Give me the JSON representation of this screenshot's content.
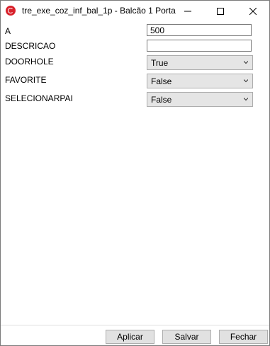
{
  "window": {
    "title": "tre_exe_coz_inf_bal_1p - Balcão 1 Porta",
    "icon": "app-logo-icon",
    "controls": [
      "minimize-icon",
      "maximize-icon",
      "close-icon"
    ]
  },
  "properties": [
    {
      "label": "A",
      "kind": "text",
      "value": "500"
    },
    {
      "label": "DESCRICAO",
      "kind": "text",
      "value": ""
    },
    {
      "label": "DOORHOLE",
      "kind": "select",
      "value": "True"
    },
    {
      "label": "FAVORITE",
      "kind": "select",
      "value": "False"
    },
    {
      "label": "SELECIONARPAI",
      "kind": "select",
      "value": "False"
    }
  ],
  "footer": {
    "apply_label": "Aplicar",
    "save_label": "Salvar",
    "close_label": "Fechar"
  },
  "colors": {
    "accent": "#d8212b"
  }
}
